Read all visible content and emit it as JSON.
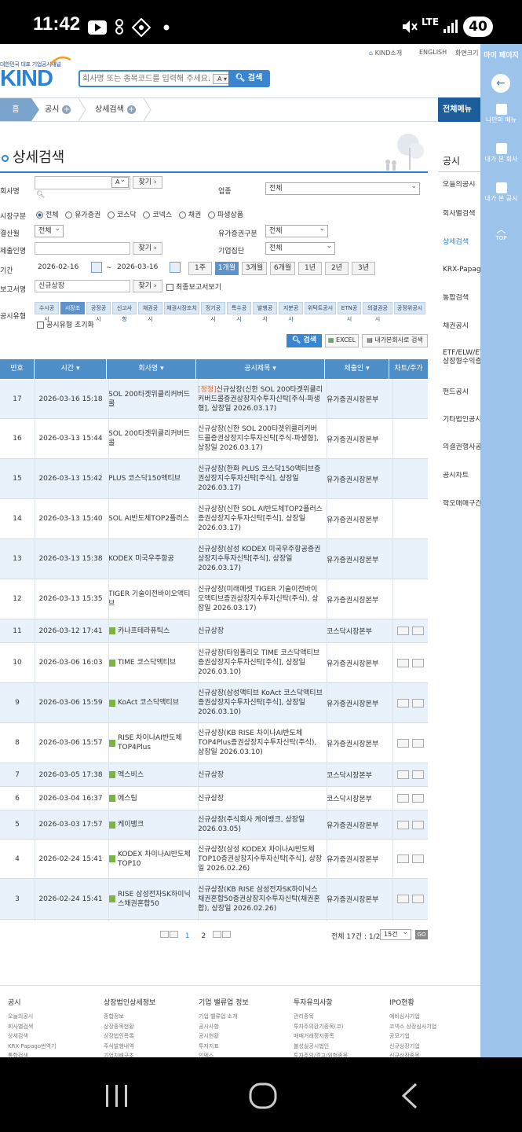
{
  "status_bar": {
    "time": "11:42",
    "lte": "LTE",
    "battery": "40"
  },
  "header": {
    "logo_sub": "대한민국 대표 기업공시채널",
    "logo": "KIND",
    "top_links": [
      "KIND소개",
      "ENGLISH",
      "화면크기"
    ],
    "search_placeholder": "회사명 또는 종목코드를 입력해 주세요.",
    "search_type": "A",
    "search_button": "검색"
  },
  "breadcrumb": {
    "home": "홈",
    "items": [
      "공시",
      "상세검색"
    ],
    "all_menu": "전체메뉴"
  },
  "right_sidebar": {
    "my_page": "마이 페이지",
    "items": [
      "나만의 메뉴",
      "내가 본 회사",
      "내가 본 공시",
      "TOP"
    ]
  },
  "page_title": "상세검색",
  "form": {
    "company_label": "회사명",
    "company_type": "A",
    "find": "찾기",
    "industry_label": "업종",
    "industry_value": "전체",
    "market_label": "시장구분",
    "market_options": [
      "전체",
      "유가증권",
      "코스닥",
      "코넥스",
      "채권",
      "파생상품"
    ],
    "fiscal_label": "결산월",
    "fiscal_value": "전체",
    "securities_label": "유가증권구분",
    "securities_value": "전체",
    "submitter_label": "제출인명",
    "group_label": "기업집단",
    "group_value": "전체",
    "period_label": "기간",
    "date_from": "2026-02-16",
    "date_sep": "~",
    "date_to": "2026-03-16",
    "period_buttons": [
      "1주",
      "1개월",
      "3개월",
      "6개월",
      "1년",
      "2년",
      "3년"
    ],
    "report_label": "보고서명",
    "report_value": "신규상장",
    "final_report": "최종보고서보기",
    "type_label": "공시유형",
    "types": [
      "수시공시",
      "시장조치",
      "공정공시",
      "신고사항",
      "채권공시",
      "채권시장조치",
      "정기공시",
      "특수공시",
      "발행공시",
      "지분공시",
      "위탁트공시",
      "ETN공시",
      "의결권공시",
      "공정위공시"
    ],
    "type_reset": "공시유형 초기화",
    "search_btn": "검색",
    "excel_btn": "EXCEL",
    "save_btn": "내가본회사로 검색"
  },
  "table": {
    "headers": [
      "번호",
      "시간",
      "회사명",
      "공시제목",
      "제출인",
      "차트/주가"
    ],
    "rows": [
      {
        "no": "17",
        "time": "2026-03-16 15:18",
        "company": "SOL 200타겟위클리커버드콜",
        "tag": "[정정]",
        "title": "신규상장(신한 SOL 200타겟위클리커버드콜증권상장지수투자신탁[주식-파생형], 상장일 2026.03.17)",
        "submitter": "유가증권시장본부",
        "chart": false,
        "alt": true
      },
      {
        "no": "16",
        "time": "2026-03-13 15:44",
        "company": "SOL 200타겟위클리커버드콜",
        "tag": "",
        "title": "신규상장(신한 SOL 200타겟위클리커버드콜증권상장지수투자신탁[주식-파생형], 상장일 2026.03.17)",
        "submitter": "유가증권시장본부",
        "chart": false,
        "alt": false
      },
      {
        "no": "15",
        "time": "2026-03-13 15:42",
        "company": "PLUS 코스닥150액티브",
        "tag": "",
        "title": "신규상장(한화 PLUS 코스닥150액티브증권상장지수투자신탁[주식], 상장일 2026.03.17)",
        "submitter": "유가증권시장본부",
        "chart": false,
        "alt": true
      },
      {
        "no": "14",
        "time": "2026-03-13 15:40",
        "company": "SOL AI반도체TOP2플러스",
        "tag": "",
        "title": "신규상장(신한 SOL AI반도체TOP2플러스증권상장지수투자신탁[주식], 상장일 2026.03.17)",
        "submitter": "유가증권시장본부",
        "chart": false,
        "alt": false
      },
      {
        "no": "13",
        "time": "2026-03-13 15:38",
        "company": "KODEX 미국우주항공",
        "tag": "",
        "title": "신규상장(삼성 KODEX 미국우주항공증권상장지수투자신탁[주식], 상장일 2026.03.17)",
        "submitter": "유가증권시장본부",
        "chart": false,
        "alt": true
      },
      {
        "no": "12",
        "time": "2026-03-13 15:35",
        "company": "TIGER 기술이전바이오액티브",
        "tag": "",
        "title": "신규상장(미래에셋 TIGER 기술이전바이오액티브증권상장지수투자신탁(주식), 상장일 2026.03.17)",
        "submitter": "유가증권시장본부",
        "chart": false,
        "alt": false
      },
      {
        "no": "11",
        "time": "2026-03-12 17:41",
        "company": "카나프테라퓨틱스",
        "tag": "",
        "title": "신규상장",
        "submitter": "코스닥시장본부",
        "chart": true,
        "alt": true
      },
      {
        "no": "10",
        "time": "2026-03-06 16:03",
        "company": "TIME 코스닥액티브",
        "tag": "",
        "title": "신규상장(타임폴리오 TIME 코스닥액티브증권상장지수투자신탁[주식], 상장일 2026.03.10)",
        "submitter": "유가증권시장본부",
        "chart": true,
        "alt": false
      },
      {
        "no": "9",
        "time": "2026-03-06 15:59",
        "company": "KoAct 코스닥액티브",
        "tag": "",
        "title": "신규상장(삼성액티브 KoAct 코스닥액티브증권상장지수투자신탁[주식], 상장일 2026.03.10)",
        "submitter": "유가증권시장본부",
        "chart": true,
        "alt": true
      },
      {
        "no": "8",
        "time": "2026-03-06 15:57",
        "company": "RISE 차이나AI반도체TOP4Plus",
        "tag": "",
        "title": "신규상장(KB RISE 차이나AI반도체TOP4Plus증권상장지수투자신탁(주식), 상장일 2026.03.10)",
        "submitter": "유가증권시장본부",
        "chart": true,
        "alt": false
      },
      {
        "no": "7",
        "time": "2026-03-05 17:38",
        "company": "엑스비스",
        "tag": "",
        "title": "신규상장",
        "submitter": "코스닥시장본부",
        "chart": true,
        "alt": true
      },
      {
        "no": "6",
        "time": "2026-03-04 16:37",
        "company": "에스팀",
        "tag": "",
        "title": "신규상장",
        "submitter": "코스닥시장본부",
        "chart": true,
        "alt": false
      },
      {
        "no": "5",
        "time": "2026-03-03 17:57",
        "company": "케이뱅크",
        "tag": "",
        "title": "신규상장(주식회사 케이뱅크, 상장일 2026.03.05)",
        "submitter": "유가증권시장본부",
        "chart": true,
        "alt": true
      },
      {
        "no": "4",
        "time": "2026-02-24 15:41",
        "company": "KODEX 차이나AI반도체TOP10",
        "tag": "",
        "title": "신규상장(삼성 KODEX 차이나AI반도체TOP10증권상장지수투자신탁[주식], 상장일 2026.02.26)",
        "submitter": "유가증권시장본부",
        "chart": true,
        "alt": false
      },
      {
        "no": "3",
        "time": "2026-02-24 15:41",
        "company": "RISE 삼성전자SK하이닉스채권혼합50",
        "tag": "",
        "title": "신규상장(KB RISE 삼성전자SK하이닉스채권혼합50증권상장지수투자신탁(채권혼합), 상장일 2026.02.26)",
        "submitter": "유가증권시장본부",
        "chart": true,
        "alt": true
      }
    ]
  },
  "pagination": {
    "pages": [
      "1",
      "2"
    ],
    "total": "전체 17건 : 1/2",
    "per_page": "15건",
    "go": "GO"
  },
  "side_menu": {
    "title": "공시",
    "items": [
      "오늘의공시",
      "회사별검색",
      "상세검색",
      "KRX-Papago",
      "통합검색",
      "채권공시",
      "ETF/ELW/ETN 상장형수익증권",
      "펀드공시",
      "기타법인공시",
      "의결권행사공시",
      "공시차트",
      "학오매매구간"
    ]
  },
  "footer": {
    "cols": [
      {
        "title": "공시",
        "items": [
          "오늘의공시",
          "회사별검색",
          "상세검색",
          "KRX-Papago번역기",
          "통합검색"
        ]
      },
      {
        "title": "상장법인상세정보",
        "items": [
          "종합정보",
          "상장종목현황",
          "상장법인목록",
          "주식발행내역",
          "기업지배구조"
        ]
      },
      {
        "title": "기업 밸류업 정보",
        "items": [
          "기업 밸류업 소개",
          "공시사항",
          "공시현황",
          "투자지표",
          "인덱스"
        ]
      },
      {
        "title": "투자유의사항",
        "items": [
          "관리종목",
          "투자주의환기종목(코)",
          "매매거래정지종목",
          "불성실공시법인",
          "투자주의/경고/위험종목"
        ]
      },
      {
        "title": "IPO현황",
        "items": [
          "예비심사기업",
          "코넥스 상장심사기업",
          "공모기업",
          "신규상장기업",
          "신규상장종목"
        ]
      }
    ]
  }
}
